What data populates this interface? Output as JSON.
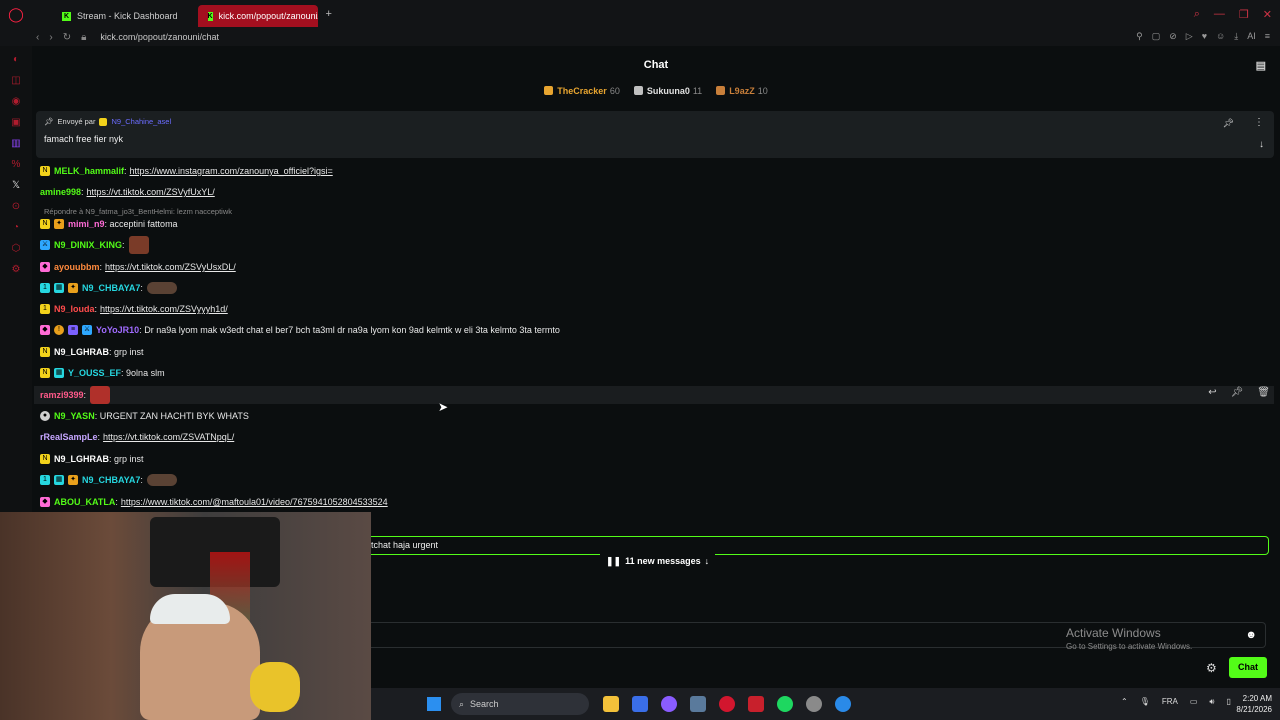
{
  "browser": {
    "tabs": [
      {
        "label": "Stream - Kick Dashboard",
        "active": false
      },
      {
        "label": "kick.com/popout/zanouni/c",
        "active": true
      }
    ],
    "url": "kick.com/popout/zanouni/chat",
    "ai_label": "AI"
  },
  "chat": {
    "title": "Chat",
    "leaderboard": [
      {
        "name": "TheCracker",
        "count": "60",
        "color": "#e8a530"
      },
      {
        "name": "Sukuuna0",
        "count": "11",
        "color": "#c0c0c0"
      },
      {
        "name": "L9azZ",
        "count": "10",
        "color": "#c87f3a"
      }
    ],
    "pinned": {
      "sent_by_label": "Envoyé par",
      "username": "N9_Chahine_asel",
      "message": "famach free fier nyk"
    },
    "reply_hint": "Répondre à N9_fatma_jo3t_BentHelmi: lezm nacceptiwk",
    "messages": [
      {
        "user": "MELK_hammalif",
        "color": "#53fc18",
        "text": "",
        "link": "https://www.instagram.com/zanounya_officiel?igsi="
      },
      {
        "user": "amine998",
        "color": "#53fc18",
        "text": "",
        "link": "https://vt.tiktok.com/ZSVyfUxYL/"
      },
      {
        "user": "mimi_n9",
        "color": "#ff6bd6",
        "text": "acceptini fattoma",
        "link": ""
      },
      {
        "user": "N9_DINIX_KING",
        "color": "#53fc18",
        "text": "",
        "link": ""
      },
      {
        "user": "ayouubbm",
        "color": "#ff8a3d",
        "text": "",
        "link": "https://vt.tiktok.com/ZSVyUsxDL/"
      },
      {
        "user": "N9_CHBAYA7",
        "color": "#26d7e0",
        "text": "",
        "link": ""
      },
      {
        "user": "N9_louda",
        "color": "#ff4c4c",
        "text": "",
        "link": "https://vt.tiktok.com/ZSVyyyh1d/"
      },
      {
        "user": "YoYoJR10",
        "color": "#a06bff",
        "text": "Dr na9a lyom mak w3edt chat el ber7 bch ta3ml dr na9a lyom kon 9ad kelmtk w eli 3ta kelmto 3ta termto",
        "link": ""
      },
      {
        "user": "N9_LGHRAB",
        "color": "#ffffff",
        "text": "grp inst",
        "link": ""
      },
      {
        "user": "Y_OUSS_EF",
        "color": "#26d7e0",
        "text": "9olna slm",
        "link": ""
      },
      {
        "user": "ramzi9399",
        "color": "#ff5a8a",
        "text": "",
        "link": ""
      },
      {
        "user": "N9_YASN",
        "color": "#53fc18",
        "text": "URGENT ZAN HACHTI BYK WHATS",
        "link": ""
      },
      {
        "user": "rRealSampLe",
        "color": "#c6a6ff",
        "text": "",
        "link": "https://vt.tiktok.com/ZSVATNpqL/"
      },
      {
        "user": "N9_LGHRAB",
        "color": "#ffffff",
        "text": "grp inst",
        "link": ""
      },
      {
        "user": "N9_CHBAYA7",
        "color": "#26d7e0",
        "text": "",
        "link": ""
      },
      {
        "user": "ABOU_KATLA",
        "color": "#53fc18",
        "text": "",
        "link": "https://www.tiktok.com/@maftoula01/video/7675941052804533524"
      }
    ],
    "preview_message": "tchat haja urgent",
    "new_messages": "11 new messages",
    "send_button": "Chat"
  },
  "windows": {
    "activate_title": "Activate Windows",
    "activate_sub": "Go to Settings to activate Windows.",
    "search_label": "Search",
    "lang": "FRA",
    "time": "2:20 AM",
    "date": "8/21/2026"
  }
}
